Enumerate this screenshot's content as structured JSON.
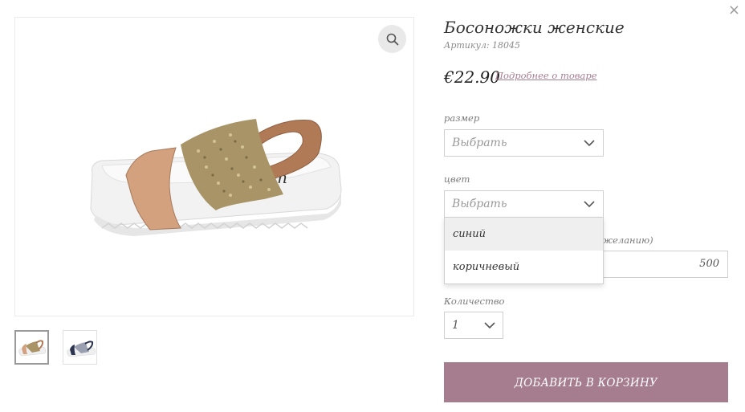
{
  "icons": {
    "close": "close-icon",
    "zoom": "search-icon",
    "chevron": "chevron-down-icon"
  },
  "close_glyph": "×",
  "product": {
    "title": "Босоножки женские",
    "sku": "Артикул: 18045",
    "price": "€22.90",
    "more_link": "Подробнее о товаре"
  },
  "options": {
    "size": {
      "label": "размер",
      "value": "Выбрать"
    },
    "color": {
      "label": "цвет",
      "value": "Выбрать",
      "dropdown": [
        "синий",
        "коричневый"
      ]
    },
    "partial_label": "желанию)",
    "partial_input_value": "500",
    "quantity": {
      "label": "Количество",
      "value": "1"
    }
  },
  "add_to_cart": "ДОБАВИТЬ В КОРЗИНУ",
  "colors": {
    "accent": "#a57d8f",
    "border": "#cfcfcf",
    "highlight": "#efefef"
  }
}
